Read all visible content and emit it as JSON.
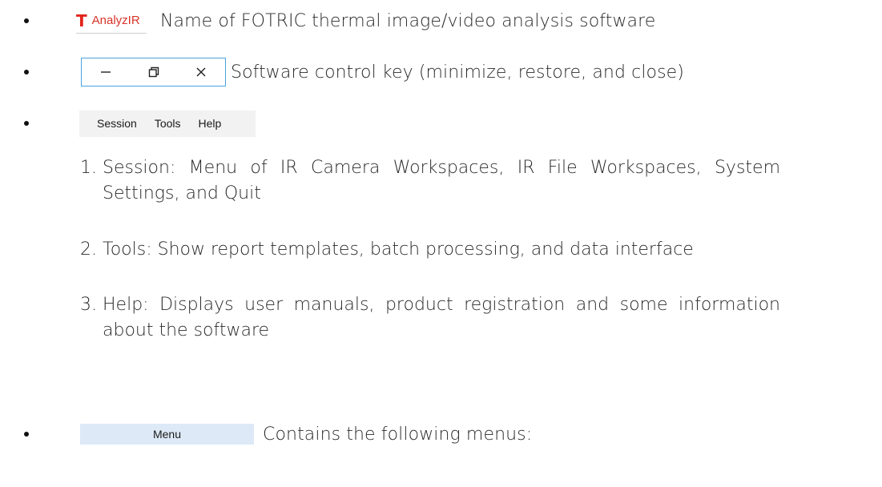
{
  "items": [
    {
      "logo": {
        "mark": "T",
        "text": "AnalyzIR"
      },
      "description": "Name of FOTRIC thermal image/video analysis software"
    },
    {
      "controls": [
        {
          "icon": "minimize-icon"
        },
        {
          "icon": "restore-icon"
        },
        {
          "icon": "close-icon"
        }
      ],
      "description": "Software control key (minimize, restore, and close)"
    },
    {
      "menubar": [
        "Session",
        "Tools",
        "Help"
      ]
    },
    {
      "menu_chip": "Menu",
      "description": "Contains the following menus:"
    }
  ],
  "numbered": [
    {
      "num": "1.",
      "text": "Session: Menu of IR Camera Workspaces, IR File Workspaces, System Settings, and Quit"
    },
    {
      "num": "2.",
      "text": "Tools: Show report templates, batch processing, and data interface"
    },
    {
      "num": "3.",
      "text": "Help: Displays user manuals, product registration and some information about the software"
    }
  ],
  "colors": {
    "logo_red": "#e2231a",
    "control_border": "#4aa3df",
    "menubar_bg": "#f2f2f2",
    "menu_chip_bg": "#dde9f6"
  }
}
